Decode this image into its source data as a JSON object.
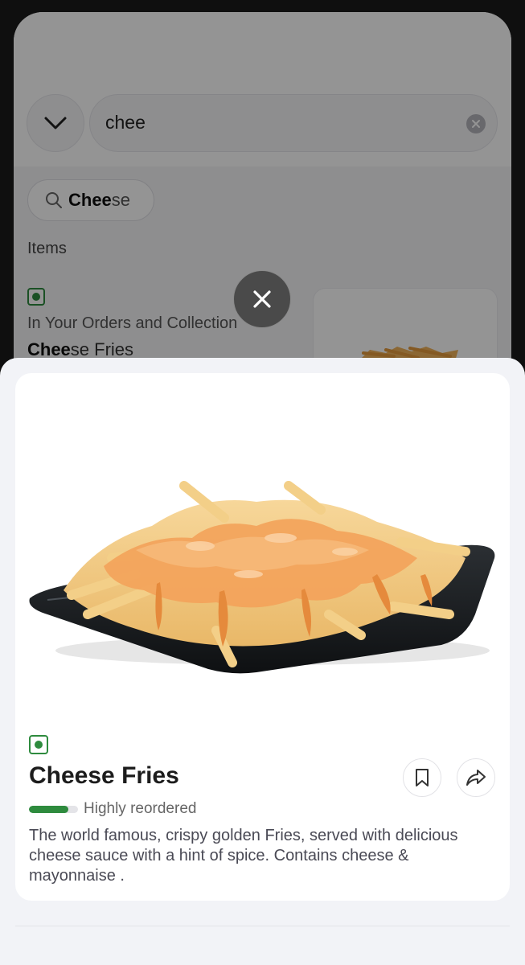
{
  "colors": {
    "veg_green": "#2e8b3e",
    "sheet_background": "#f2f3f7",
    "card_background": "#ffffff"
  },
  "background_screen": {
    "back_icon": "chevron-down-icon",
    "search": {
      "value": "chee",
      "clear_icon": "clear-x-icon"
    },
    "suggestion": {
      "icon": "search-icon",
      "match": "Chee",
      "rest": "se"
    },
    "items_heading": "Items",
    "item": {
      "veg_icon": "veg-mark-icon",
      "subtitle": "In Your Orders and Collection",
      "name_match": "Chee",
      "name_rest": "se Fries"
    }
  },
  "close_icon": "close-x-icon",
  "dish": {
    "image_icon": "cheese-fries-image",
    "veg_icon": "veg-mark-icon",
    "name": "Cheese Fries",
    "bookmark_icon": "bookmark-icon",
    "share_icon": "share-arrow-icon",
    "reorder_label": "Highly reordered",
    "reorder_level": 0.8,
    "description": "The world famous, crispy golden Fries, served with delicious cheese sauce with a hint of spice. Contains cheese & mayonnaise ."
  }
}
